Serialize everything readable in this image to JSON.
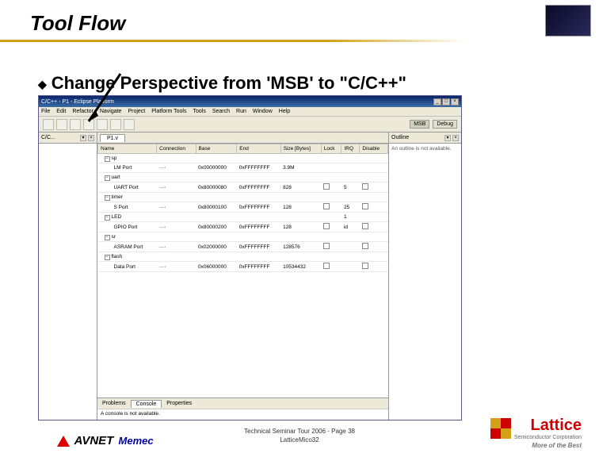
{
  "slide": {
    "title": "Tool Flow",
    "bullet": "Change Perspective from 'MSB' to \"C/C++\""
  },
  "eclipse": {
    "title": "C/C++ - P1 - Eclipse Platform",
    "menu": [
      "File",
      "Edit",
      "Refactor",
      "Navigate",
      "Project",
      "Platform Tools",
      "Tools",
      "Search",
      "Run",
      "Window",
      "Help"
    ],
    "perspectives": {
      "msb": "MSB",
      "debug": "Debug"
    },
    "leftPanel": {
      "tab": "C/C... "
    },
    "editor": {
      "tab": "P1.v"
    },
    "columns": [
      "Name",
      "Connection",
      "Base",
      "End",
      "Size [Bytes]",
      "Lock",
      "IRQ",
      "Disable"
    ],
    "rows": [
      {
        "type": "parent",
        "name": "sp",
        "base": "",
        "end": "",
        "size": "",
        "lock": "",
        "irq": "",
        "dis": ""
      },
      {
        "type": "child",
        "name": "LM Port",
        "base": "0x00000000",
        "end": "0xFFFFFFFF",
        "size": "3.9M",
        "lock": "",
        "irq": "",
        "dis": ""
      },
      {
        "type": "parent",
        "name": "uart",
        "base": "",
        "end": "",
        "size": "",
        "lock": "",
        "irq": "",
        "dis": ""
      },
      {
        "type": "child",
        "name": "UART Port",
        "base": "0x80000080",
        "end": "0xFFFFFFFF",
        "size": "828",
        "lock": "cb",
        "irq": "5",
        "dis": "cb"
      },
      {
        "type": "parent",
        "name": "timer",
        "base": "",
        "end": "",
        "size": "",
        "lock": "",
        "irq": "",
        "dis": ""
      },
      {
        "type": "child",
        "name": "S Port",
        "base": "0x80000100",
        "end": "0xFFFFFFFF",
        "size": "128",
        "lock": "cb",
        "irq": "25",
        "dis": "cb"
      },
      {
        "type": "parent",
        "name": "LED",
        "base": "",
        "end": "",
        "size": "",
        "lock": "",
        "irq": "1",
        "dis": ""
      },
      {
        "type": "child",
        "name": "GPIO Port",
        "base": "0x80000200",
        "end": "0xFFFFFFFF",
        "size": "128",
        "lock": "cb",
        "irq": "id",
        "dis": "cb"
      },
      {
        "type": "parent",
        "name": "sr",
        "base": "",
        "end": "",
        "size": "",
        "lock": "",
        "irq": "",
        "dis": ""
      },
      {
        "type": "child",
        "name": "ASRAM Port",
        "base": "0x02000000",
        "end": "0xFFFFFFFF",
        "size": "128576",
        "lock": "cb",
        "irq": "",
        "dis": "cb"
      },
      {
        "type": "parent",
        "name": "flash",
        "base": "",
        "end": "",
        "size": "",
        "lock": "",
        "irq": "",
        "dis": ""
      },
      {
        "type": "child",
        "name": "Data Port",
        "base": "0x06000000",
        "end": "0xFFFFFFFF",
        "size": "10534432",
        "lock": "cb",
        "irq": "",
        "dis": "cb"
      }
    ],
    "bottomTabs": {
      "problems": "Problems",
      "console": "Console",
      "properties": "Properties"
    },
    "consoleMsg": "A console is not available.",
    "rightPanel": {
      "tab": "Outline",
      "msg": "An outline is not available."
    }
  },
  "footer": {
    "line1": "Technical Seminar Tour 2006   -   Page 38",
    "line2": "LatticeMico32",
    "avnet": "AVNET",
    "memec": "Memec",
    "lattice": "Lattice",
    "latticeSub": "Semiconductor Corporation",
    "latticeTag": "More of the Best"
  }
}
